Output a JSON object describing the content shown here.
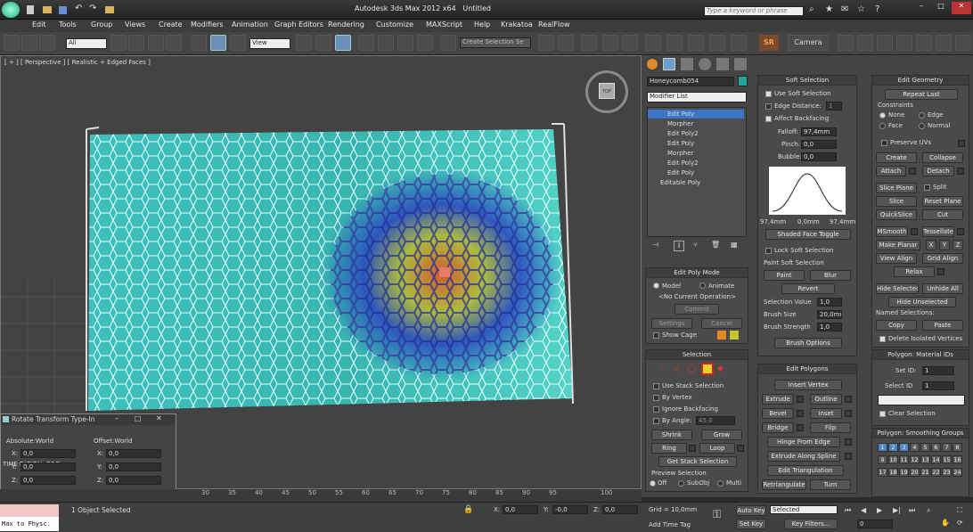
{
  "window": {
    "title": "Autodesk 3ds Max  2012 x64",
    "doc": "Untitled",
    "search_placeholder": "Type a keyword or phrase"
  },
  "menu": [
    "Edit",
    "Tools",
    "Group",
    "Views",
    "Create",
    "Modifiers",
    "Animation",
    "Graph Editors",
    "Rendering",
    "Customize",
    "MAXScript",
    "Help",
    "Krakatoa",
    "RealFlow"
  ],
  "toolbar": {
    "filter": "All",
    "ref_coord": "View",
    "selection_set": "Create Selection Se",
    "camera_label": "Camera",
    "sr_label": "SR"
  },
  "viewport": {
    "label": "[ + ] [ Perspective ] [ Realistic + Edged Faces ]",
    "cube_face": "TOP"
  },
  "modify": {
    "object_name": "Honeycomb054",
    "object_color": "#1fa89a",
    "modifier_list": "Modifier List",
    "stack": [
      "Edit Poly",
      "Morpher",
      "Edit Poly2",
      "Edit Poly",
      "Morpher",
      "Edit Poly2",
      "Edit Poly",
      "Editable Poly"
    ]
  },
  "edit_poly_mode": {
    "title": "Edit Poly Mode",
    "model": "Model",
    "animate": "Animate",
    "operation": "<No Current Operation>",
    "commit": "Commit",
    "settings": "Settings",
    "cancel": "Cancel",
    "show_cage": "Show Cage"
  },
  "selection": {
    "title": "Selection",
    "use_stack": "Use Stack Selection",
    "by_vertex": "By Vertex",
    "ignore_backfacing": "Ignore Backfacing",
    "by_angle": "By Angle:",
    "angle_value": "45,0",
    "shrink": "Shrink",
    "grow": "Grow",
    "ring": "Ring",
    "loop": "Loop",
    "get_stack": "Get Stack Selection",
    "preview": "Preview Selection",
    "off": "Off",
    "subobj": "SubObj",
    "multi": "Multi"
  },
  "soft_selection": {
    "title": "Soft Selection",
    "use_soft": "Use Soft Selection",
    "edge_distance": "Edge Distance:",
    "edge_distance_value": "1",
    "affect_backfacing": "Affect Backfacing",
    "falloff": "Falloff:",
    "falloff_value": "97,4mm",
    "pinch": "Pinch:",
    "pinch_value": "0,0",
    "bubble": "Bubble:",
    "bubble_value": "0,0",
    "curve_left": "97,4mm",
    "curve_mid": "0,0mm",
    "curve_right": "97,4mm",
    "shaded_face": "Shaded Face Toggle",
    "lock_soft": "Lock Soft Selection",
    "paint_group": "Paint Soft Selection",
    "paint": "Paint",
    "blur": "Blur",
    "revert": "Revert",
    "selection_value": "Selection Value",
    "selection_value_v": "1,0",
    "brush_size": "Brush Size",
    "brush_size_v": "20,0mm",
    "brush_strength": "Brush Strength",
    "brush_strength_v": "1,0",
    "brush_options": "Brush Options"
  },
  "edit_polygons": {
    "title": "Edit Polygons",
    "insert_vertex": "Insert Vertex",
    "extrude": "Extrude",
    "outline": "Outline",
    "bevel": "Bevel",
    "inset": "Inset",
    "bridge": "Bridge",
    "flip": "Flip",
    "hinge": "Hinge From Edge",
    "extrude_spline": "Extrude Along Spline",
    "edit_tri": "Edit Triangulation",
    "retriangulate": "Retriangulate",
    "turn": "Turn"
  },
  "edit_geometry": {
    "title": "Edit Geometry",
    "repeat_last": "Repeat Last",
    "constraints": "Constraints",
    "none": "None",
    "edge": "Edge",
    "face": "Face",
    "normal": "Normal",
    "preserve_uvs": "Preserve UVs",
    "create": "Create",
    "collapse": "Collapse",
    "attach": "Attach",
    "detach": "Detach",
    "slice_plane": "Slice Plane",
    "split": "Split",
    "slice": "Slice",
    "reset_plane": "Reset Plane",
    "quickslice": "QuickSlice",
    "cut": "Cut",
    "msmooth": "MSmooth",
    "tessellate": "Tessellate",
    "make_planar": "Make Planar",
    "x": "X",
    "y": "Y",
    "z": "Z",
    "view_align": "View Align",
    "grid_align": "Grid Align",
    "relax": "Relax",
    "hide_selected": "Hide Selected",
    "unhide_all": "Unhide All",
    "hide_unselected": "Hide Unselected",
    "named_selections": "Named Selections:",
    "copy": "Copy",
    "paste": "Paste",
    "delete_isolated": "Delete Isolated Vertices"
  },
  "material_ids": {
    "title": "Polygon: Material IDs",
    "set_id": "Set ID:",
    "set_id_v": "1",
    "select_id": "Select ID",
    "select_id_v": "1",
    "clear_selection": "Clear Selection"
  },
  "smoothing": {
    "title": "Polygon: Smoothing Groups",
    "groups": [
      "1",
      "2",
      "3",
      "4",
      "5",
      "6",
      "7",
      "8",
      "9",
      "10",
      "11",
      "12",
      "13",
      "14",
      "15",
      "16",
      "17",
      "18",
      "19",
      "20",
      "21",
      "22",
      "23",
      "24"
    ],
    "active": [
      "1",
      "2",
      "3"
    ]
  },
  "rotate_dialog": {
    "title": "Rotate Transform Type-In",
    "absolute": "Absolute:World",
    "offset": "Offset:World",
    "x": "X:",
    "y": "Y:",
    "z": "Z:",
    "abs_x": "0,0",
    "abs_y": "0,0",
    "abs_z": "0,0",
    "off_x": "0,0",
    "off_y": "0,0",
    "off_z": "0,0",
    "watermark": "TIME DIGITAL ORG"
  },
  "timeline": {
    "ticks": [
      "30",
      "35",
      "40",
      "45",
      "50",
      "55",
      "60",
      "65",
      "70",
      "75",
      "80",
      "85",
      "90",
      "95",
      "100"
    ]
  },
  "status": {
    "script_listener": "Max to Physc.",
    "selected_count": "1 Object Selected",
    "x_label": "X:",
    "x_val": "0,0",
    "y_label": "Y:",
    "y_val": "-0,0",
    "z_label": "Z:",
    "z_val": "0,0",
    "grid": "Grid = 10,0mm",
    "add_time_tag": "Add Time Tag",
    "auto_key": "Auto Key",
    "set_key": "Set Key",
    "selected": "Selected",
    "key_filters": "Key Filters...",
    "frame": "0"
  }
}
